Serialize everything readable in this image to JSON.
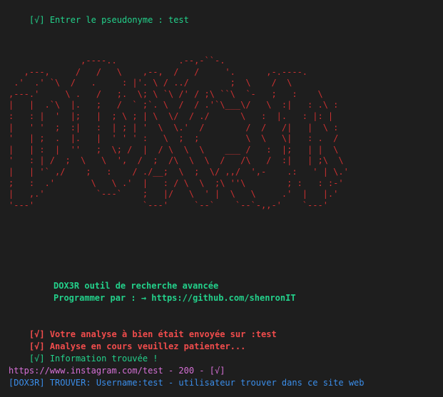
{
  "prompt": {
    "mark": "[√]",
    "text": " Entrer le pseudonyme : test"
  },
  "ascii_art": "              ,----..            .--,-``-.\n   ,---,     /   /   \\    ,--,  /   /     '.      ,-.----.\n .'  .' `\\  /   .     : |'. \\ / ../        ;  \\    /  \\\n,---.'     \\ .   /   ;.  \\; \\ `\\ /' / ;\\ ``\\  `-   ;   :    \\\n|   |  .`\\  |.   ;   /  ` ;`. \\  /  / .'`\\___\\/   \\  :|   : .\\ :\n:   : |  '  |;   |  ; \\ ; | \\  \\/  / ./      \\   :  |.   : |: |\n|   ' '  ;  :|   :  | ; | '  \\  \\.'  /        /  /   /|   |  \\ :\n'   | ;  .  |.   |  ' ' ' :   \\  ;  ;         \\  \\   \\|   : .  /\n|   | :  |  ''   ;  \\; /  |  / \\  \\  \\    ___ /   :  |;   | |  \\\n'   : | /  ;  \\   \\  ',  /  ;  /\\  \\  \\  /   /\\   /  :|   | ;\\  \\\n|   | '` ,/    ;   :    / ./__;  \\  ;  \\/ ,,/  ',-    .:   ' | \\.'\n;   :  .'       \\   \\ .'  |   : / \\  \\  ;\\ ''\\        ; :   : :-'\n|   ,.'          `---`    ;   |/   \\  ' |  \\   \\     .'  |   |.'\n'---'                     `---'     `--`    `--`-,,-'    `---'",
  "banner": {
    "title": "DOX3R outil de recherche avancée",
    "author_line": "Programmer par : → https://github.com/shenronIT"
  },
  "status_lines": [
    {
      "mark": "[√]",
      "text": " Votre analyse à bien était envoyée sur :test"
    },
    {
      "mark": "[√]",
      "text": " Analyse en cours veuillez patienter..."
    }
  ],
  "found": {
    "mark": "[√]",
    "text": " Information trouvée !"
  },
  "result": {
    "url_line": "https://www.instagram.com/test - 200 - [√]",
    "hit_line": "[DOX3R] TROUVER: Username:test - utilisateur trouver dans ce site web"
  },
  "colors": {
    "background": "#1e1e1e",
    "green": "#23d18b",
    "red": "#f14c4c",
    "ascii_red": "#cd3131",
    "purple": "#d670d6",
    "blue": "#3b8eea"
  }
}
